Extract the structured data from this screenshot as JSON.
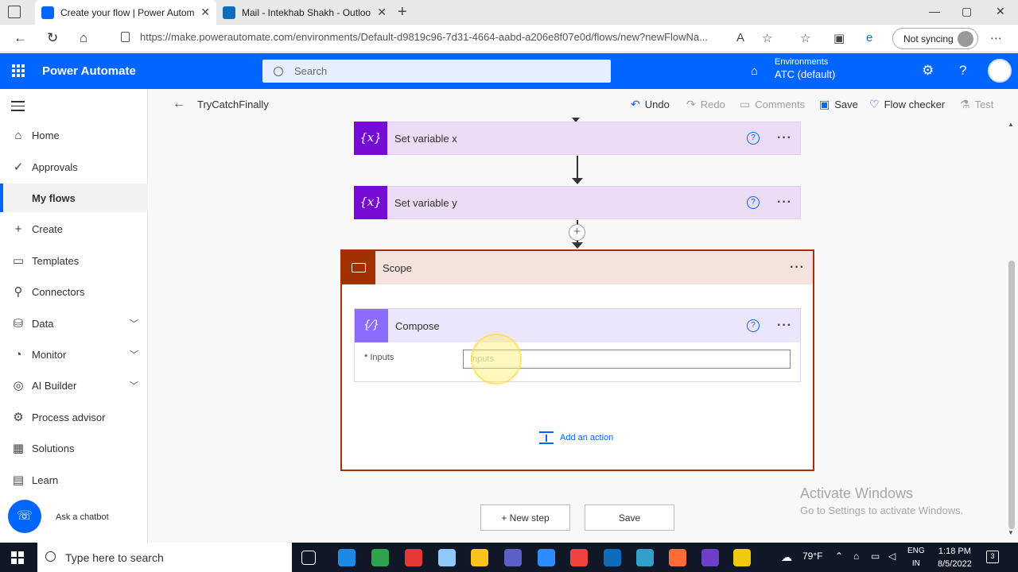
{
  "browser": {
    "tabs": [
      {
        "title": "Create your flow | Power Automa",
        "favicon_color": "#0066ff",
        "active": true
      },
      {
        "title": "Mail - Intekhab Shakh - Outlook",
        "favicon_color": "#0f6cbd",
        "active": false
      }
    ],
    "url": "https://make.powerautomate.com/environments/Default-d9819c96-7d31-4664-aabd-a206e8f07e0d/flows/new?newFlowNa...",
    "sync_label": "Not syncing"
  },
  "app": {
    "name": "Power Automate",
    "search_placeholder": "Search",
    "environment_label": "Environments",
    "environment_value": "ATC (default)",
    "brand_color": "#0066ff"
  },
  "sidebar": {
    "items": [
      {
        "label": "Home",
        "icon": "home-icon",
        "glyph": "⌂"
      },
      {
        "label": "Approvals",
        "icon": "approvals-icon",
        "glyph": "✓"
      },
      {
        "label": "My flows",
        "icon": "flows-icon",
        "glyph": "",
        "active": true
      },
      {
        "label": "Create",
        "icon": "plus-icon",
        "glyph": "+"
      },
      {
        "label": "Templates",
        "icon": "templates-icon",
        "glyph": "▭"
      },
      {
        "label": "Connectors",
        "icon": "connectors-icon",
        "glyph": "⚲"
      },
      {
        "label": "Data",
        "icon": "data-icon",
        "glyph": "⛁",
        "expandable": true
      },
      {
        "label": "Monitor",
        "icon": "monitor-icon",
        "glyph": "◔",
        "expandable": true
      },
      {
        "label": "AI Builder",
        "icon": "ai-builder-icon",
        "glyph": "◎",
        "expandable": true
      },
      {
        "label": "Process advisor",
        "icon": "process-advisor-icon",
        "glyph": "⚙"
      },
      {
        "label": "Solutions",
        "icon": "solutions-icon",
        "glyph": "▦"
      },
      {
        "label": "Learn",
        "icon": "learn-icon",
        "glyph": "▤"
      }
    ],
    "chatbot_label": "Ask a chatbot"
  },
  "toolbar": {
    "flow_name": "TryCatchFinally",
    "undo": "Undo",
    "redo": "Redo",
    "comments": "Comments",
    "save": "Save",
    "flow_checker": "Flow checker",
    "test": "Test"
  },
  "flow": {
    "actions": [
      {
        "title": "Set variable x",
        "icon": "variable-icon",
        "icon_text": "{x}"
      },
      {
        "title": "Set variable y",
        "icon": "variable-icon",
        "icon_text": "{x}"
      }
    ],
    "scope": {
      "title": "Scope",
      "color": "#a33000",
      "compose": {
        "title": "Compose",
        "icon_text": "{⁄}",
        "inputs_label": "Inputs",
        "inputs_placeholder": "Inputs",
        "inputs_value": ""
      },
      "add_action": "Add an action"
    },
    "new_step": "+ New step",
    "save": "Save"
  },
  "watermark": {
    "line1": "Activate Windows",
    "line2": "Go to Settings to activate Windows."
  },
  "taskbar": {
    "search_placeholder": "Type here to search",
    "weather": "79°F",
    "lang_1": "ENG",
    "lang_2": "IN",
    "time": "1:18 PM",
    "date": "8/5/2022",
    "notification_count": "3",
    "apps": [
      {
        "name": "task-view-icon",
        "color": "#ffffff"
      },
      {
        "name": "edge-legacy-icon",
        "color": "#1e88e5"
      },
      {
        "name": "edge-icon",
        "color": "#2ea44f"
      },
      {
        "name": "chrome-icon",
        "color": "#e53935"
      },
      {
        "name": "notes-icon",
        "color": "#90caf9"
      },
      {
        "name": "file-explorer-icon",
        "color": "#f9c31f"
      },
      {
        "name": "teams-icon",
        "color": "#5b5fc7"
      },
      {
        "name": "zoom-icon",
        "color": "#2d8cff"
      },
      {
        "name": "anydesk-icon",
        "color": "#ef443b"
      },
      {
        "name": "mail-icon",
        "color": "#0f6cbd"
      },
      {
        "name": "app-icon",
        "color": "#30a0c8"
      },
      {
        "name": "postman-icon",
        "color": "#ff6c37"
      },
      {
        "name": "github-icon",
        "color": "#6e40c9"
      },
      {
        "name": "power-bi-icon",
        "color": "#f2c811"
      }
    ]
  }
}
